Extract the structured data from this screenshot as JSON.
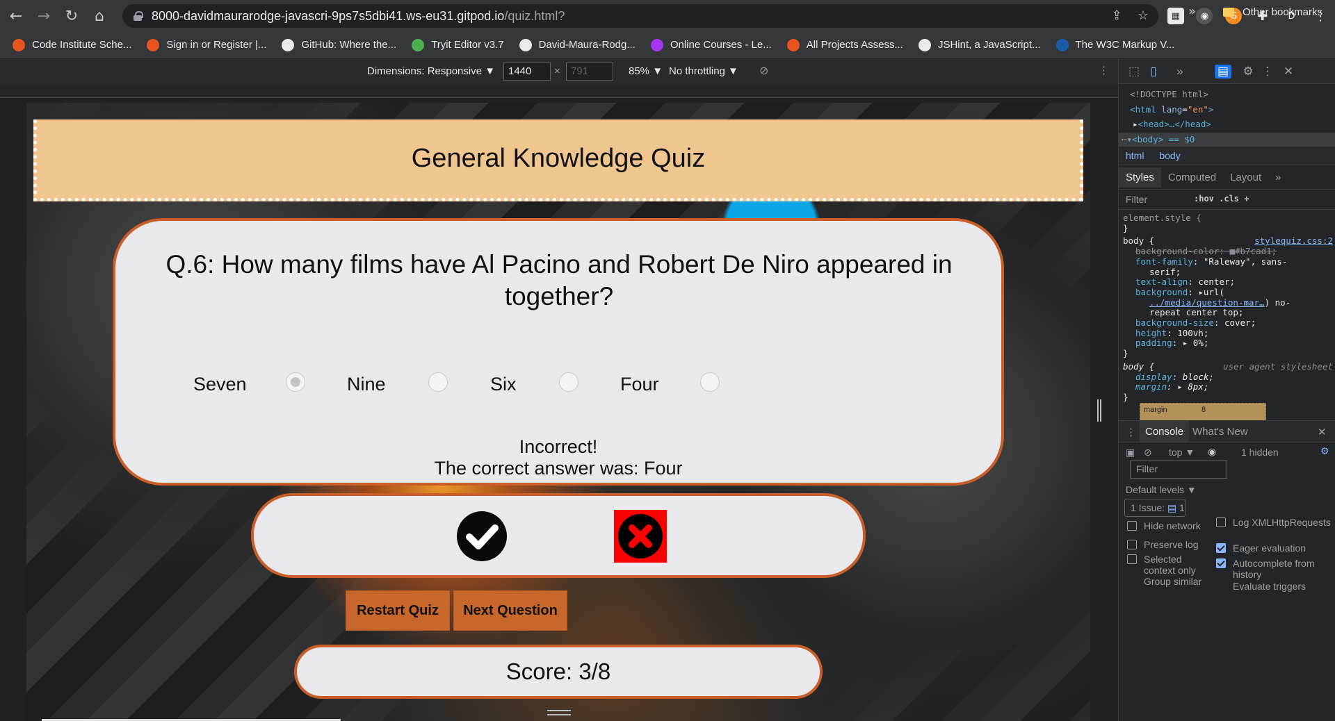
{
  "browser": {
    "url_main": "8000-davidmaurarodge-javascri-9ps7s5dbi41.ws-eu31.gitpod.io",
    "url_path": "/quiz.html?",
    "profile_initial": "D"
  },
  "bookmarks": [
    {
      "label": "Code Institute Sche...",
      "color": "#e8531f"
    },
    {
      "label": "Sign in or Register |...",
      "color": "#e8531f"
    },
    {
      "label": "GitHub: Where the...",
      "color": "#e8eaed"
    },
    {
      "label": "Tryit Editor v3.7",
      "color": "#4caf50"
    },
    {
      "label": "David-Maura-Rodg...",
      "color": "#e8eaed"
    },
    {
      "label": "Online Courses - Le...",
      "color": "#a435f0"
    },
    {
      "label": "All Projects Assess...",
      "color": "#e8531f"
    },
    {
      "label": "JSHint, a JavaScript...",
      "color": "#e8eaed"
    },
    {
      "label": "The W3C Markup V...",
      "color": "#1a5ca8"
    }
  ],
  "bookmarks_more": "»",
  "bookmarks_other": "Other bookmarks",
  "device_toolbar": {
    "dimensions_label": "Dimensions: Responsive ▼",
    "width": "1440",
    "height": "791",
    "times": "×",
    "zoom": "85% ▼",
    "throttling": "No throttling ▼"
  },
  "quiz": {
    "title": "General Knowledge Quiz",
    "question": "Q.6: How many films have Al Pacino and Robert De Niro appeared in together?",
    "options": [
      {
        "label": "Seven",
        "checked": true
      },
      {
        "label": "Nine",
        "checked": false
      },
      {
        "label": "Six",
        "checked": false
      },
      {
        "label": "Four",
        "checked": false
      }
    ],
    "feedback_line1": "Incorrect!",
    "feedback_line2": "The correct answer was: Four",
    "restart_label": "Restart Quiz",
    "next_label": "Next Question",
    "score_text": "Score: 3/8"
  },
  "devtools": {
    "elements": {
      "doctype": "<!DOCTYPE html>",
      "html_open": "<html",
      "lang_attr": "lang",
      "lang_val": "\"en\"",
      "head": "<head>…</head>",
      "body_row": "<body> == $0"
    },
    "crumbs": [
      "html",
      "body"
    ],
    "tabs": [
      "Styles",
      "Computed",
      "Layout",
      "»"
    ],
    "filter_placeholder": "Filter",
    "filter_hov": ":hov  .cls  +",
    "styles": {
      "element_style": "element.style {",
      "close": "}",
      "body_selector": "body {",
      "source": "stylequiz.css:2",
      "bg_color": "background-color: ■#b7cad1;",
      "font_family_prop": "font-family",
      "font_family_val": ": \"Raleway\", sans-",
      "font_family_val2": "serif;",
      "text_align_prop": "text-align",
      "text_align_val": ": center;",
      "background_prop": "background",
      "background_val": ": ▸url(",
      "url_link": "../media/question-mar…",
      "url_rest": ") no-",
      "bg_rest": "repeat center top;",
      "bg_size_prop": "background-size",
      "bg_size_val": ": cover;",
      "height_prop": "height",
      "height_val": ": 100vh;",
      "padding_prop": "padding",
      "padding_val": ": ▸ 0%;",
      "ua_selector": "body {",
      "ua_source": "user agent stylesheet",
      "display_prop": "display",
      "display_val": ": block;",
      "margin_prop": "margin",
      "margin_val": ": ▸ 8px;"
    },
    "box_model": {
      "label": "margin",
      "value": "8"
    },
    "console": {
      "tab_console": "Console",
      "tab_whats_new": "What's New",
      "context": "top ▼",
      "hidden": "1 hidden",
      "filter_placeholder": "Filter",
      "levels": "Default levels ▼",
      "issue": "1 Issue:",
      "issue_count": "1",
      "checkboxes": [
        {
          "label": "Hide network",
          "checked": false
        },
        {
          "label": "Log XMLHttpRequests",
          "checked": false
        },
        {
          "label": "Preserve log",
          "checked": false
        },
        {
          "label": "Eager evaluation",
          "checked": true
        },
        {
          "label": "Selected context only",
          "checked": false
        },
        {
          "label": "Autocomplete from history",
          "checked": true
        },
        {
          "label": "Group similar",
          "checked": false
        },
        {
          "label": "Evaluate triggers",
          "checked": false
        }
      ]
    }
  }
}
